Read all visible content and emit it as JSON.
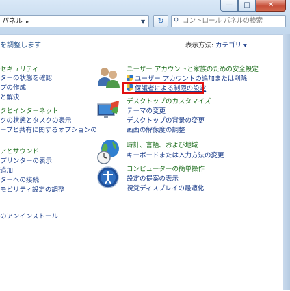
{
  "window": {
    "minimize_glyph": "—",
    "maximize_glyph": "□",
    "close_glyph": "✕"
  },
  "address_bar": {
    "path": "パネル",
    "chevron": "▸",
    "dropdown": "▼",
    "refresh_glyph": "↻"
  },
  "search": {
    "placeholder": "コントロール パネルの検索",
    "icon": "search-icon"
  },
  "header": {
    "title": "を調整します",
    "view_by_label": "表示方法:",
    "view_by_value": "カテゴリ ▾"
  },
  "left_column": {
    "system_security": {
      "title": "セキュリティ",
      "links": [
        "ターの状態を確認",
        "プの作成",
        "と解決"
      ]
    },
    "network": {
      "title": "クとインターネット",
      "links": [
        "クの状態とタスクの表示",
        "ープと共有に関するオプションの"
      ]
    },
    "hardware_sound": {
      "title": "アとサウンド",
      "links": [
        "プリンターの表示",
        "追加",
        "ターへの接続",
        "モビリティ設定の調整"
      ]
    },
    "programs": {
      "links": [
        "のアンインストール"
      ]
    }
  },
  "right_column": {
    "user_accounts": {
      "title": "ユーザー アカウントと家族のための安全設定",
      "links": [
        "ユーザー アカウントの追加または削除",
        "保護者による制限の設定"
      ],
      "icon": "user-accounts-icon"
    },
    "appearance": {
      "title": "デスクトップのカスタマイズ",
      "links": [
        "テーマの変更",
        "デスクトップの背景の変更",
        "画面の解像度の調整"
      ],
      "icon": "desktop-customize-icon"
    },
    "clock_region": {
      "title": "時計、言語、および地域",
      "links": [
        "キーボードまたは入力方法の変更"
      ],
      "icon": "globe-clock-icon"
    },
    "ease_of_access": {
      "title": "コンピューターの簡単操作",
      "links": [
        "設定の提案の表示",
        "視覚ディスプレイの最適化"
      ],
      "icon": "ease-of-access-icon"
    }
  }
}
